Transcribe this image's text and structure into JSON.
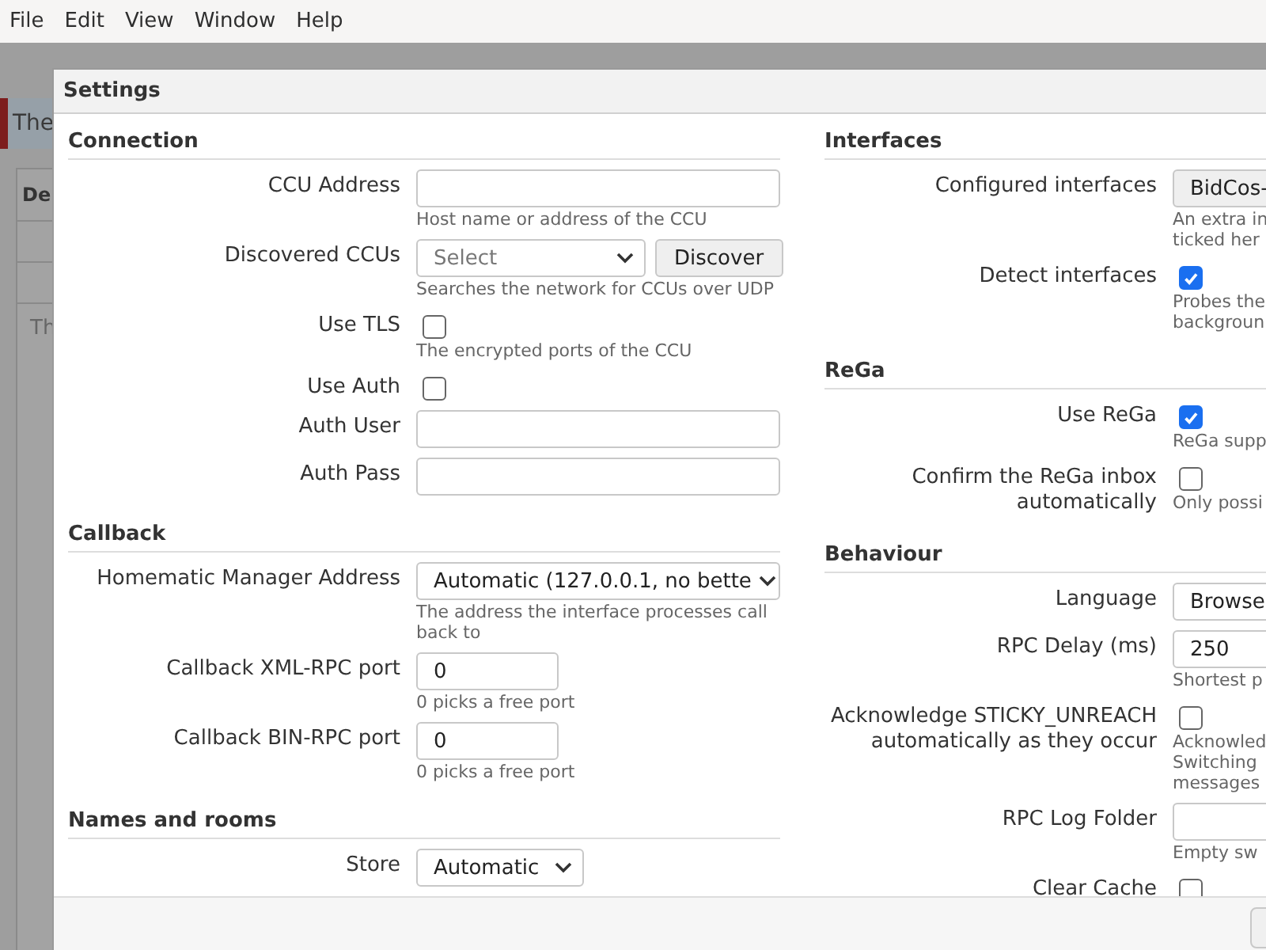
{
  "menu": [
    {
      "label": "File"
    },
    {
      "label": "Edit"
    },
    {
      "label": "View"
    },
    {
      "label": "Window"
    },
    {
      "label": "Help"
    }
  ],
  "background": {
    "banner": "The",
    "panel_header": "De",
    "panel_text": "Th"
  },
  "dialog": {
    "title": "Settings",
    "columns": [
      [
        {
          "heading": "Connection",
          "rows": [
            {
              "kind": "text",
              "label": "CCU Address",
              "hint": [
                "Host name or address of the CCU"
              ]
            },
            {
              "kind": "select_button",
              "label": "Discovered CCUs",
              "placeholder": "Select",
              "button": "Discover",
              "hint": [
                "Searches the network for CCUs over UDP"
              ]
            },
            {
              "kind": "checkbox",
              "label": "Use TLS",
              "checked": false,
              "hint": [
                "The encrypted ports of the CCU"
              ]
            },
            {
              "kind": "checkbox",
              "label": "Use Auth",
              "checked": false
            },
            {
              "kind": "text",
              "label": "Auth User"
            },
            {
              "kind": "text",
              "label": "Auth Pass"
            }
          ]
        },
        {
          "heading": "Callback",
          "rows": [
            {
              "kind": "select",
              "label": "Homematic Manager Address",
              "value": "Automatic (127.0.0.1, no bette",
              "hint": [
                "The address the interface processes call back to"
              ]
            },
            {
              "kind": "number",
              "label": "Callback XML-RPC port",
              "value": "0",
              "hint": [
                "0 picks a free port"
              ]
            },
            {
              "kind": "number",
              "label": "Callback BIN-RPC port",
              "value": "0",
              "hint": [
                "0 picks a free port"
              ]
            }
          ]
        },
        {
          "heading": "Names and rooms",
          "rows": [
            {
              "kind": "select_small",
              "label": "Store",
              "value": "Automatic"
            }
          ]
        }
      ],
      [
        {
          "heading": "Interfaces",
          "rows": [
            {
              "kind": "button",
              "label": "Configured interfaces",
              "button": "BidCos-",
              "hint": [
                "An extra in",
                "ticked her"
              ]
            },
            {
              "kind": "checkbox",
              "label": "Detect interfaces",
              "checked": true,
              "hint": [
                "Probes the",
                "backgroun"
              ]
            }
          ]
        },
        {
          "heading": "ReGa",
          "rows": [
            {
              "kind": "checkbox",
              "label": "Use ReGa",
              "checked": true,
              "hint": [
                "ReGa supp"
              ]
            },
            {
              "kind": "checkbox",
              "label": "Confirm the ReGa inbox automatically",
              "checked": false,
              "hint": [
                "Only possi"
              ]
            }
          ]
        },
        {
          "heading": "Behaviour",
          "rows": [
            {
              "kind": "select",
              "label": "Language",
              "value": "Browse"
            },
            {
              "kind": "number",
              "label": "RPC Delay (ms)",
              "value": "250",
              "hint": [
                "Shortest p"
              ]
            },
            {
              "kind": "checkbox",
              "label": "Acknowledge STICKY_UNREACH automatically as they occur",
              "checked": false,
              "hint": [
                "Acknowled",
                "Switching",
                "messages"
              ]
            },
            {
              "kind": "text",
              "label": "RPC Log Folder",
              "hint": [
                "Empty sw"
              ]
            },
            {
              "kind": "checkbox",
              "label": "Clear Cache",
              "checked": false
            }
          ]
        }
      ]
    ]
  }
}
